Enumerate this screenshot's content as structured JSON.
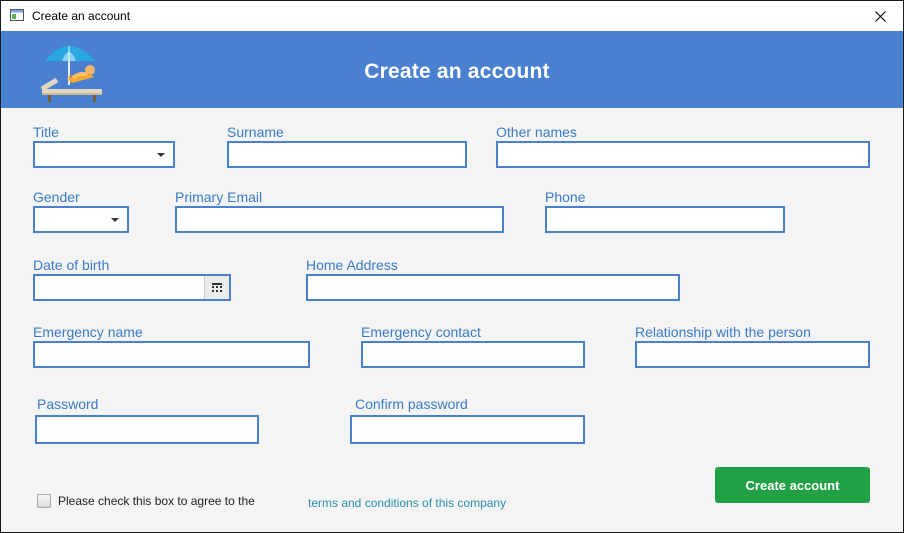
{
  "window": {
    "title": "Create an account"
  },
  "header": {
    "heading": "Create an account"
  },
  "form": {
    "title_label": "Title",
    "surname_label": "Surname",
    "other_names_label": "Other names",
    "gender_label": "Gender",
    "email_label": "Primary Email",
    "phone_label": "Phone",
    "dob_label": "Date of birth",
    "address_label": "Home Address",
    "emergency_name_label": "Emergency name",
    "emergency_contact_label": "Emergency contact",
    "relationship_label": "Relationship with the person",
    "password_label": "Password",
    "confirm_password_label": "Confirm password"
  },
  "footer": {
    "agree_text": "Please check this box to agree to the",
    "terms_link": "terms and conditions of this company",
    "submit_label": "Create account"
  },
  "colors": {
    "banner": "#4a80d0",
    "label": "#3a7bc8",
    "field_border": "#4a80d0",
    "submit": "#21a045",
    "link": "#2a8fa8"
  },
  "icons": {
    "window_icon": "app-window-icon",
    "logo": "beach-lounger-icon",
    "close": "close-icon",
    "calendar": "calendar-icon",
    "dropdown": "chevron-down-icon"
  }
}
